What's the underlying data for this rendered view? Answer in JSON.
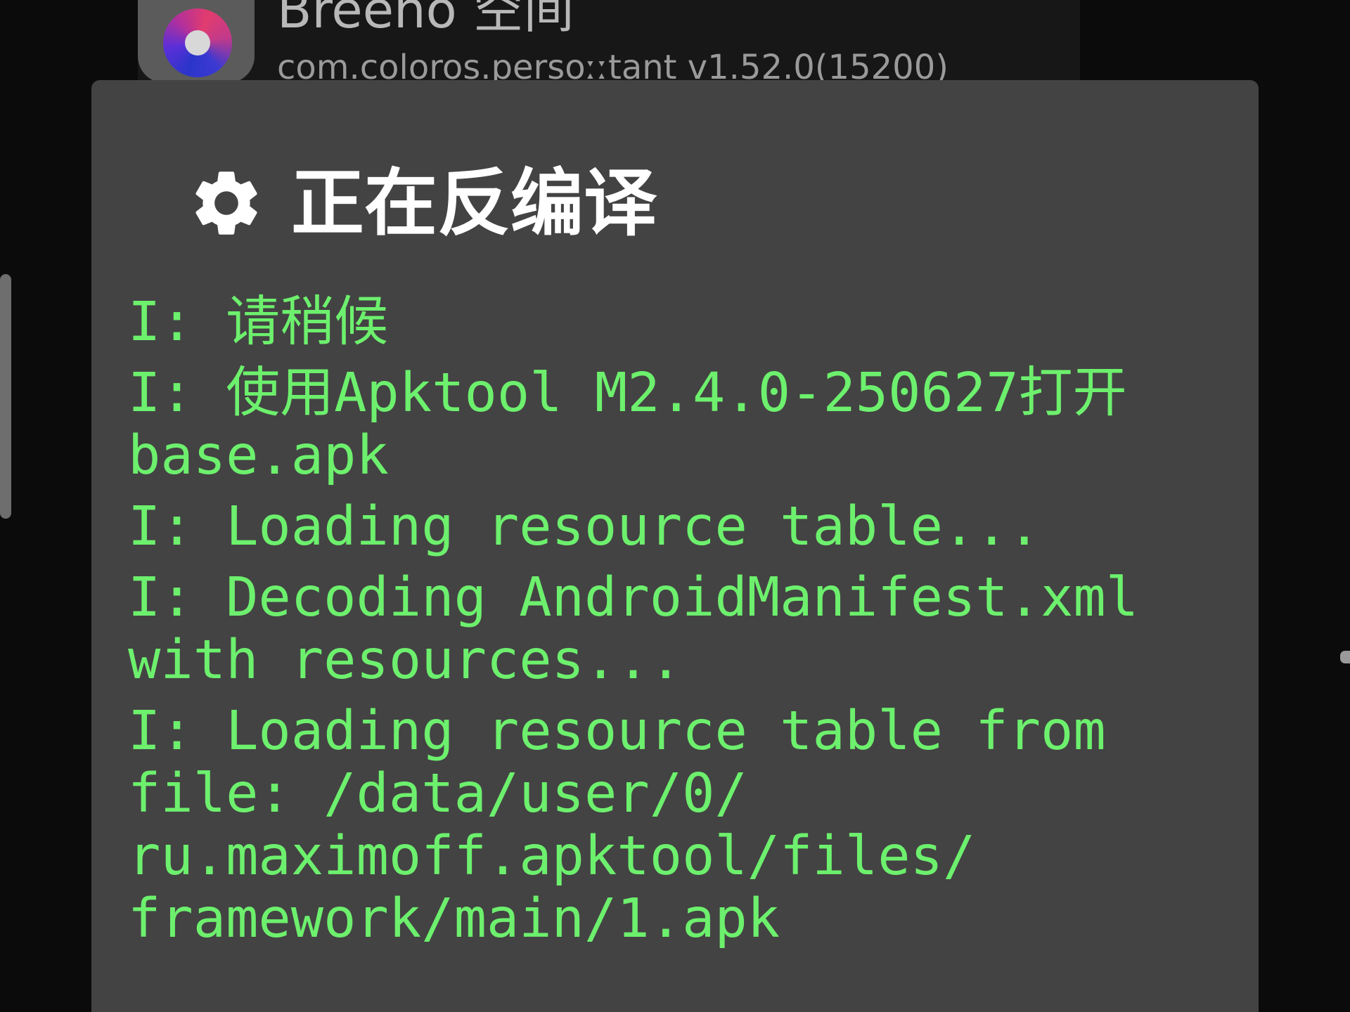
{
  "background_app": {
    "name": "Breeno 空间",
    "package": "com.coloros.persoːːtant v1.52.0(15200)",
    "icon": "breeno-ring-icon"
  },
  "dialog": {
    "title": "正在反编译",
    "title_icon": "gear-icon",
    "log_color": "#6df06d",
    "log_lines": [
      "I: 请稍候",
      "I: 使用Apktool M2.4.0-250627打开 base.apk",
      "I: Loading resource table...",
      "I: Decoding AndroidManifest.xml with resources...",
      "I: Loading resource table from file: /data/user/0/ ru.maximoff.apktool/files/ framework/main/1.apk"
    ]
  }
}
